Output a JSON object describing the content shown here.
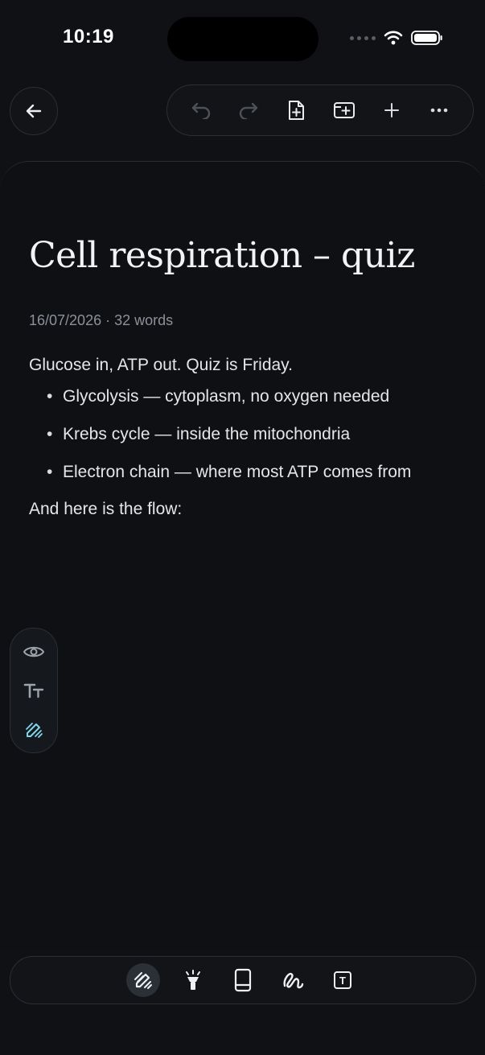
{
  "status": {
    "time": "10:19"
  },
  "toolbar": {
    "icons": [
      "back-arrow-icon",
      "undo-icon",
      "redo-icon",
      "new-page-icon",
      "insert-page-icon",
      "plus-icon",
      "more-icon"
    ]
  },
  "note": {
    "title": "Cell respiration – quiz",
    "meta": "16/07/2026 · 32 words",
    "intro": "Glucose in, ATP out. Quiz is Friday.",
    "bullets": [
      "Glycolysis — cytoplasm, no oxygen needed",
      "Krebs cycle — inside the mitochondria",
      "Electron chain — where most ATP comes from"
    ],
    "outro": "And here is the flow:"
  },
  "rail": {
    "icons": [
      "eye-icon",
      "text-size-icon",
      "pen-icon"
    ],
    "active": "pen-icon"
  },
  "bottom_tools": {
    "icons": [
      "pen-tool-icon",
      "highlighter-icon",
      "eraser-icon",
      "lasso-icon",
      "text-box-icon"
    ],
    "active": "pen-tool-icon",
    "text_tool_label": "T"
  },
  "colors": {
    "accent": "#7fd6ea",
    "background": "#0f1115",
    "muted": "#8c9098"
  }
}
